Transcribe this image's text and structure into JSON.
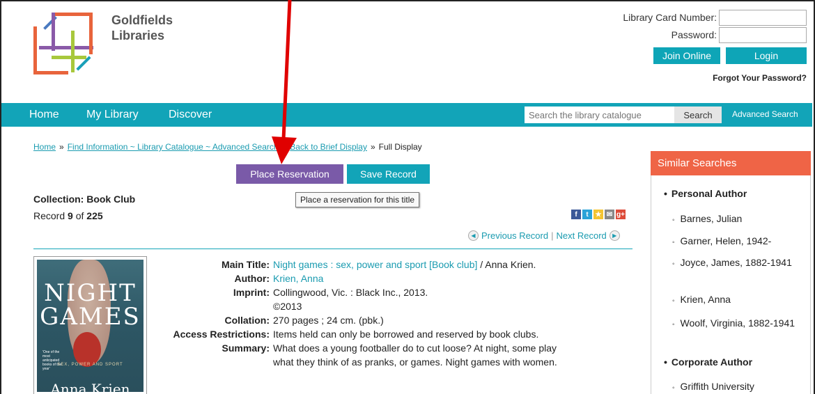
{
  "header": {
    "logo_line1": "Goldfields",
    "logo_line2": "Libraries",
    "card_label": "Library Card Number:",
    "password_label": "Password:",
    "card_value": "",
    "password_value": "",
    "join_label": "Join Online",
    "login_label": "Login",
    "forgot_label": "Forgot Your Password?"
  },
  "nav": {
    "home": "Home",
    "my_library": "My Library",
    "discover": "Discover",
    "search_placeholder": "Search the library catalogue",
    "search_button": "Search",
    "advanced": "Advanced Search"
  },
  "breadcrumb": {
    "home": "Home",
    "find": "Find Information ~ Library Catalogue ~ Advanced Search",
    "back": "Back to Brief Display",
    "current": "Full Display",
    "separator": "»"
  },
  "actions": {
    "place_reservation": "Place Reservation",
    "save_record": "Save Record",
    "tooltip": "Place a reservation for this title"
  },
  "record": {
    "collection": "Collection: Book Club",
    "record_prefix": "Record ",
    "record_num": "9",
    "record_of": " of ",
    "record_total": "225",
    "previous": "Previous Record",
    "next": "Next Record",
    "divider": "|"
  },
  "share_icons": [
    "facebook-icon",
    "twitter-icon",
    "favorite-icon",
    "email-icon",
    "googleplus-icon"
  ],
  "cover": {
    "title_1": "NIGHT",
    "title_2": "GAMES",
    "subtitle": "SEX, POWER AND SPORT",
    "author": "Anna Krien",
    "blurb": "'One of the most anticipated books of the year'"
  },
  "details": [
    {
      "label": "Main Title:",
      "link": "Night games : sex, power and sport [Book club]",
      "text": " / Anna Krien."
    },
    {
      "label": "Author:",
      "link": "Krien, Anna",
      "text": ""
    },
    {
      "label": "Imprint:",
      "link": "",
      "text": "Collingwood, Vic. : Black Inc., 2013."
    },
    {
      "label": "",
      "link": "",
      "text": "©2013"
    },
    {
      "label": "Collation:",
      "link": "",
      "text": "270 pages ; 24 cm. (pbk.)"
    },
    {
      "label": "Access Restrictions:",
      "link": "",
      "text": "Items held can only be borrowed and reserved by book clubs."
    },
    {
      "label": "Summary:",
      "link": "",
      "text": "What does a young footballer do to cut loose? At night, some play"
    },
    {
      "label": "",
      "link": "",
      "text": "what they think of as pranks, or games. Night games with women."
    }
  ],
  "sidebar": {
    "title": "Similar Searches",
    "personal_author": "Personal Author",
    "authors": [
      "Barnes, Julian",
      "Garner, Helen, 1942-",
      "Joyce, James, 1882-1941",
      "Krien, Anna",
      "Woolf, Virginia, 1882-1941"
    ],
    "corporate_author": "Corporate Author",
    "corporate": [
      "Griffith University"
    ]
  },
  "colors": {
    "teal": "#12a4b8",
    "purple": "#7a5aa8",
    "orange": "#ef6446",
    "annotation_arrow": "#e00000"
  }
}
